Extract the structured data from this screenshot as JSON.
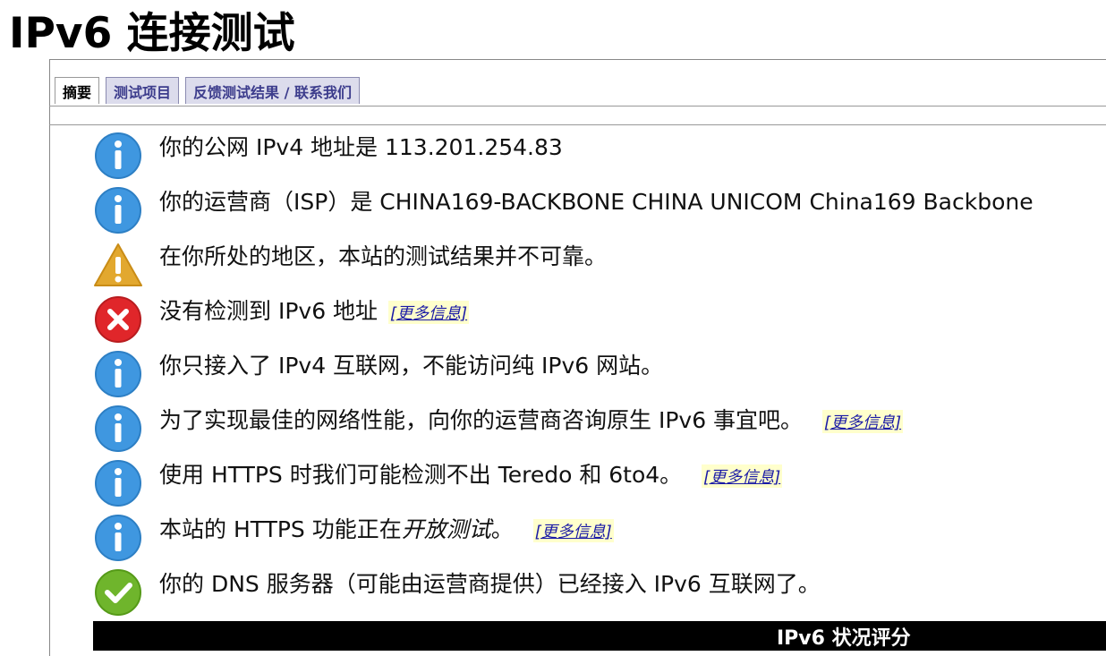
{
  "page": {
    "title": "IPv6 连接测试"
  },
  "tabs": [
    {
      "label": "摘要",
      "active": true
    },
    {
      "label": "测试项目",
      "active": false
    },
    {
      "label": "反馈测试结果 / 联系我们",
      "active": false
    }
  ],
  "results": [
    {
      "icon": "info-icon",
      "text": "你的公网 IPv4 地址是 113.201.254.83"
    },
    {
      "icon": "info-icon",
      "text": "你的运营商（ISP）是 CHINA169-BACKBONE CHINA UNICOM China169 Backbone"
    },
    {
      "icon": "warning-icon",
      "text": "在你所处的地区，本站的测试结果并不可靠。"
    },
    {
      "icon": "error-icon",
      "text": "没有检测到 IPv6 地址",
      "more": "[更多信息]"
    },
    {
      "icon": "info-icon",
      "text": "你只接入了 IPv4 互联网，不能访问纯 IPv6 网站。"
    },
    {
      "icon": "info-icon",
      "text": "为了实现最佳的网络性能，向你的运营商咨询原生 IPv6 事宜吧。",
      "more": "[更多信息]"
    },
    {
      "icon": "info-icon",
      "text": "使用 HTTPS 时我们可能检测不出 Teredo 和 6to4。",
      "more": "[更多信息]"
    },
    {
      "icon": "info-icon",
      "text_before": "本站的 HTTPS 功能正在",
      "text_italic": "开放测试",
      "text_after": "。",
      "more": "[更多信息]"
    },
    {
      "icon": "success-icon",
      "text": "你的 DNS 服务器（可能由运营商提供）已经接入 IPv6 互联网了。"
    }
  ],
  "score_section": {
    "title": "IPv6 状况评分"
  },
  "colors": {
    "info": "#3f97e0",
    "warning": "#e2a82f",
    "error": "#e0262a",
    "success": "#6fb52c",
    "tab_bg": "#dcdcec",
    "tab_text": "#3c3c8c",
    "more_bg": "#ffffcc",
    "more_text": "#1a1aa6"
  }
}
